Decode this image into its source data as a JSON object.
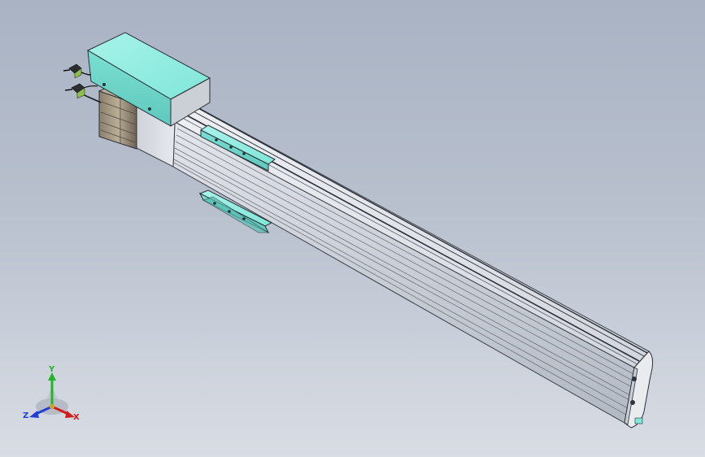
{
  "viewport": {
    "background_top": "#a9b3c3",
    "background_bottom": "#d9dde4"
  },
  "model": {
    "part_color": "#c9ced6",
    "accent_color": "#7fe6d8",
    "edge_color": "#2a2f38"
  },
  "triad": {
    "x_label": "X",
    "y_label": "Y",
    "z_label": "Z",
    "x_color": "#d21c1c",
    "y_color": "#22b52a",
    "z_color": "#2040d8"
  }
}
